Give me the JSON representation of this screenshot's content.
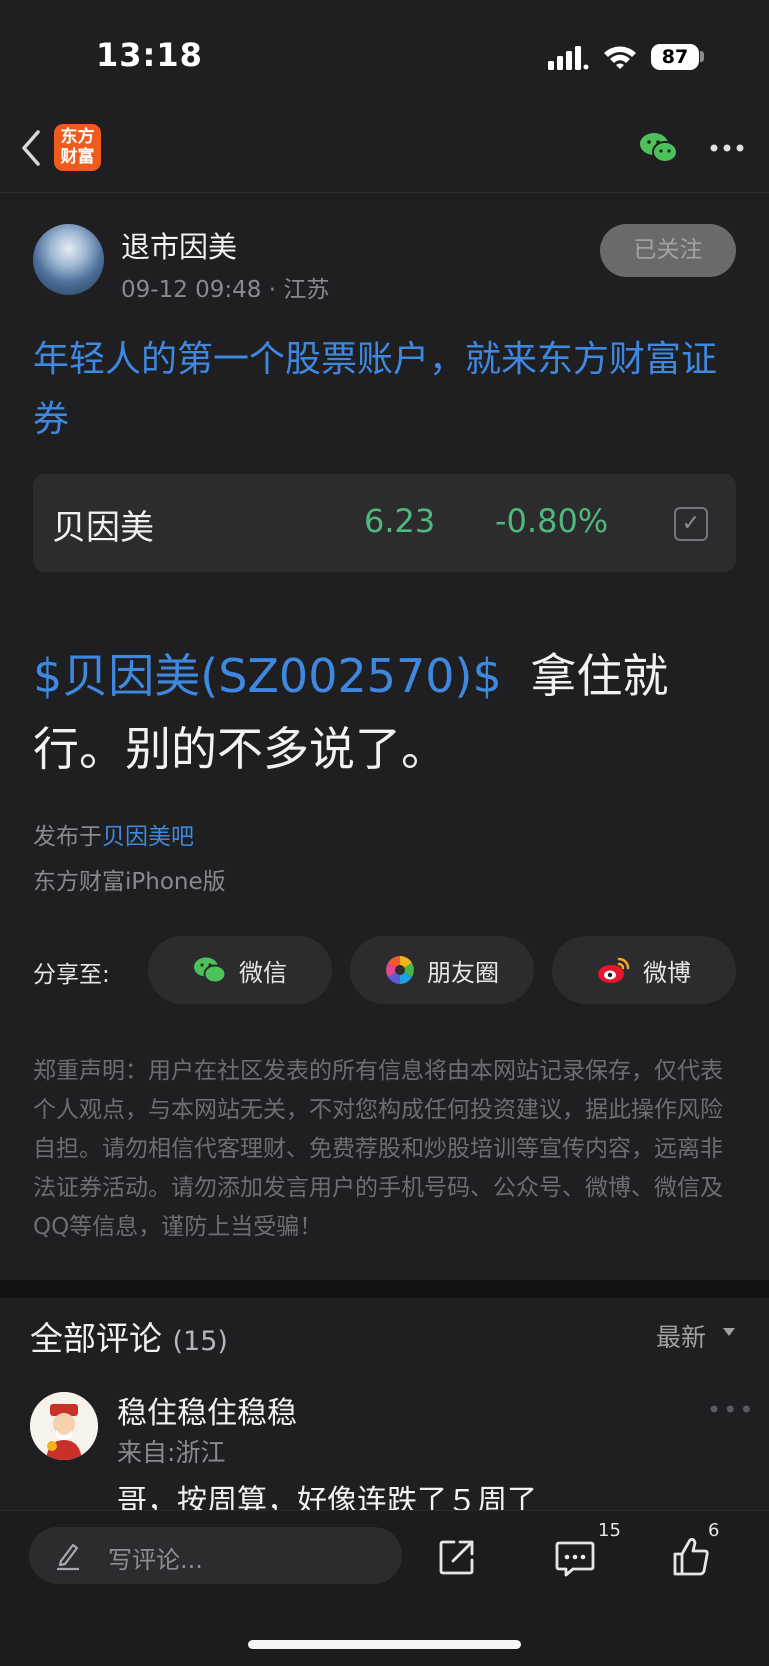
{
  "status_bar": {
    "time": "13:18",
    "battery": "87"
  },
  "nav": {
    "logo_line1": "东方",
    "logo_line2": "财富"
  },
  "author": {
    "name": "退市因美",
    "time": "09-12 09:48",
    "location": "江苏",
    "follow_label": "已关注"
  },
  "headline": "年轻人的第一个股票账户，就来东方财富证券",
  "stock": {
    "name": "贝因美",
    "price": "6.23",
    "change": "-0.80%"
  },
  "post": {
    "stock_tag": "$贝因美(SZ002570)$",
    "text": "拿住就行。别的不多说了。",
    "published_prefix": "发布于",
    "bar_name": "贝因美吧",
    "source": "东方财富iPhone版"
  },
  "share": {
    "label": "分享至:",
    "wechat": "微信",
    "moments": "朋友圈",
    "weibo": "微博"
  },
  "disclaimer": "郑重声明：用户在社区发表的所有信息将由本网站记录保存，仅代表个人观点，与本网站无关，不对您构成任何投资建议，据此操作风险自担。请勿相信代客理财、免费荐股和炒股培训等宣传内容，远离非法证券活动。请勿添加发言用户的手机号码、公众号、微博、微信及QQ等信息，谨防上当受骗！",
  "comments": {
    "title": "全部评论",
    "count": "(15)",
    "sort_label": "最新",
    "items": [
      {
        "name": "稳住稳住稳稳",
        "location": "来自:浙江",
        "text": "哥，按周算，好像连跌了５周了"
      }
    ]
  },
  "bottom_bar": {
    "placeholder": "写评论...",
    "comment_count": "15",
    "like_count": "6"
  },
  "colors": {
    "accent_blue": "#3e88e0",
    "stock_green": "#4fb87d",
    "background": "#1f1f21"
  }
}
